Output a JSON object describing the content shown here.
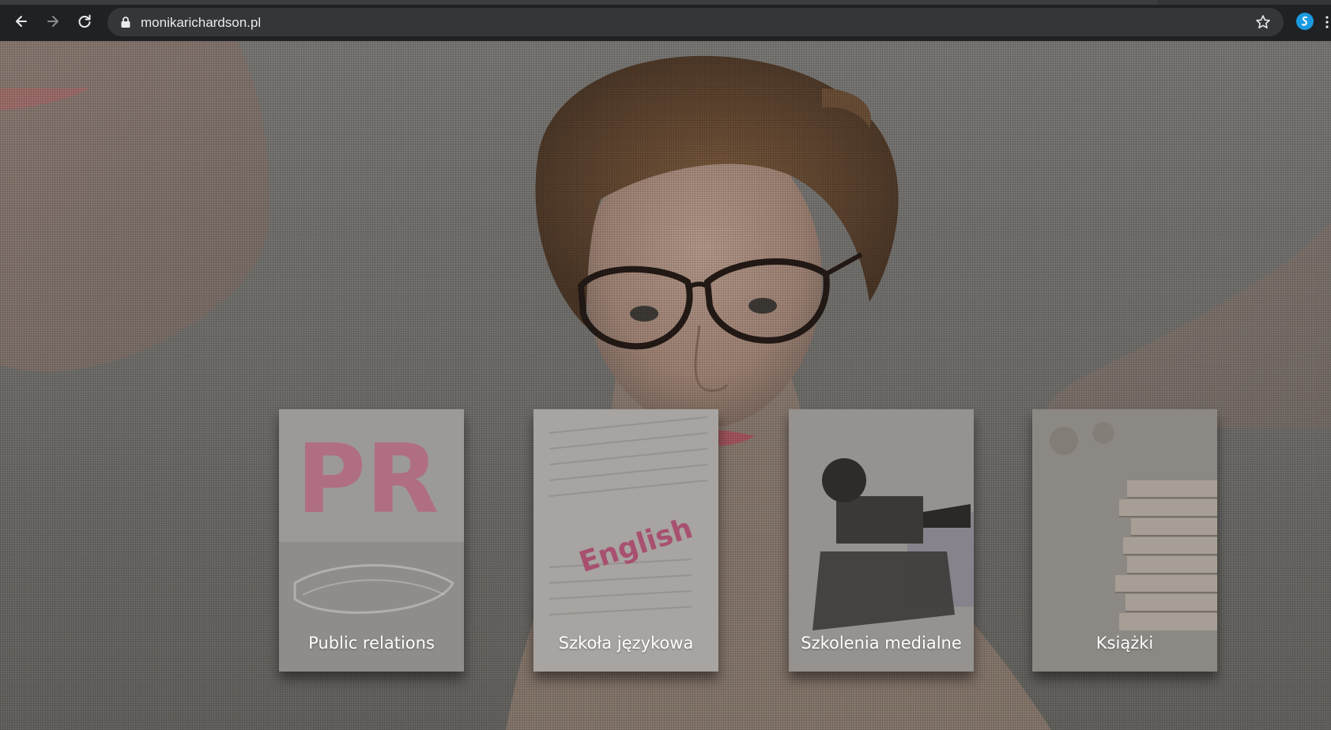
{
  "browser": {
    "url": "monikarichardson.pl",
    "icons": [
      "back-icon",
      "forward-icon",
      "reload-icon",
      "lock-icon",
      "star-icon",
      "extension-icon",
      "more-icon"
    ]
  },
  "cards": [
    {
      "label": "Public relations",
      "art_text": "PR"
    },
    {
      "label": "Szkoła językowa",
      "art_text": "English"
    },
    {
      "label": "Szkolenia medialne"
    },
    {
      "label": "Książki"
    }
  ],
  "colors": {
    "chrome_bg": "#202124",
    "omnibox_bg": "#35363a",
    "card_label": "#ffffff",
    "pr_pink": "#e0557a",
    "pr_blue": "#5aa6c8",
    "english_red": "#c0305a"
  }
}
